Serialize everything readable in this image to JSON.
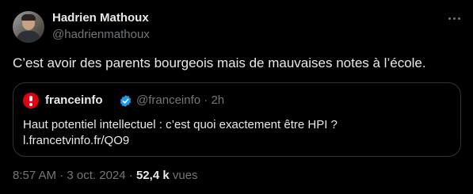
{
  "author": {
    "name": "Hadrien Mathoux",
    "handle": "@hadrienmathoux"
  },
  "tweet": {
    "text": "C’est avoir des parents bourgeois mais de mauvaises notes à l’école."
  },
  "quoted": {
    "name": "franceinfo",
    "handle": "@franceinfo",
    "separator": "·",
    "time": "2h",
    "text": "Haut potentiel intellectuel : c’est quoi exactement être HPI ?",
    "link": "l.francetvinfo.fr/QO9",
    "verified_icon": "verified-badge-icon",
    "brand_color": "#e1000f"
  },
  "footer": {
    "time": "8:57 AM",
    "separator": "·",
    "date": "3 oct. 2024",
    "separator2": "·",
    "views_count": "52,4 k",
    "views_label": "vues"
  },
  "colors": {
    "background": "#000000",
    "text": "#e7e9ea",
    "secondary": "#71767b",
    "border": "#2f3336",
    "verified": "#1d9bf0"
  },
  "icons": {
    "more": "more-horizontal-icon"
  }
}
